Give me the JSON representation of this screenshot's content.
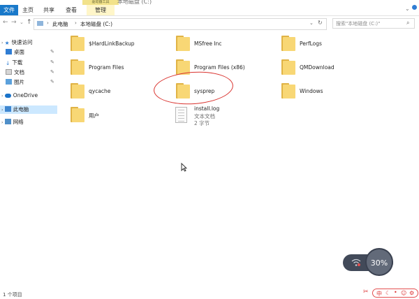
{
  "window": {
    "title_fragment": "本地磁盘 (C:)",
    "context_group": "驱动器工具"
  },
  "ribbon": {
    "tabs": [
      "文件",
      "主页",
      "共享",
      "查看",
      "管理"
    ]
  },
  "address": {
    "crumbs": [
      "此电脑",
      "本地磁盘 (C:)"
    ],
    "search_placeholder": "搜索\"本地磁盘 (C:)\""
  },
  "sidebar": {
    "quick_access": "快速访问",
    "items": [
      "桌面",
      "下载",
      "文档",
      "图片"
    ],
    "onedrive": "OneDrive",
    "this_pc": "此电脑",
    "network": "网络"
  },
  "files": {
    "folders": [
      "$HardLinkBackup",
      "MSfree Inc",
      "PerfLogs",
      "Program Files",
      "Program Files (x86)",
      "QMDownload",
      "qycache",
      "sysprep",
      "Windows",
      "用户"
    ],
    "log": {
      "name": "install.log",
      "type": "文本文档",
      "size": "2 字节"
    }
  },
  "status": {
    "count": "1 个项目"
  },
  "overlay": {
    "percent": "30%"
  },
  "colors": {
    "accent": "#1979ca",
    "folder": "#f8d775",
    "annotation": "#d9322e"
  }
}
